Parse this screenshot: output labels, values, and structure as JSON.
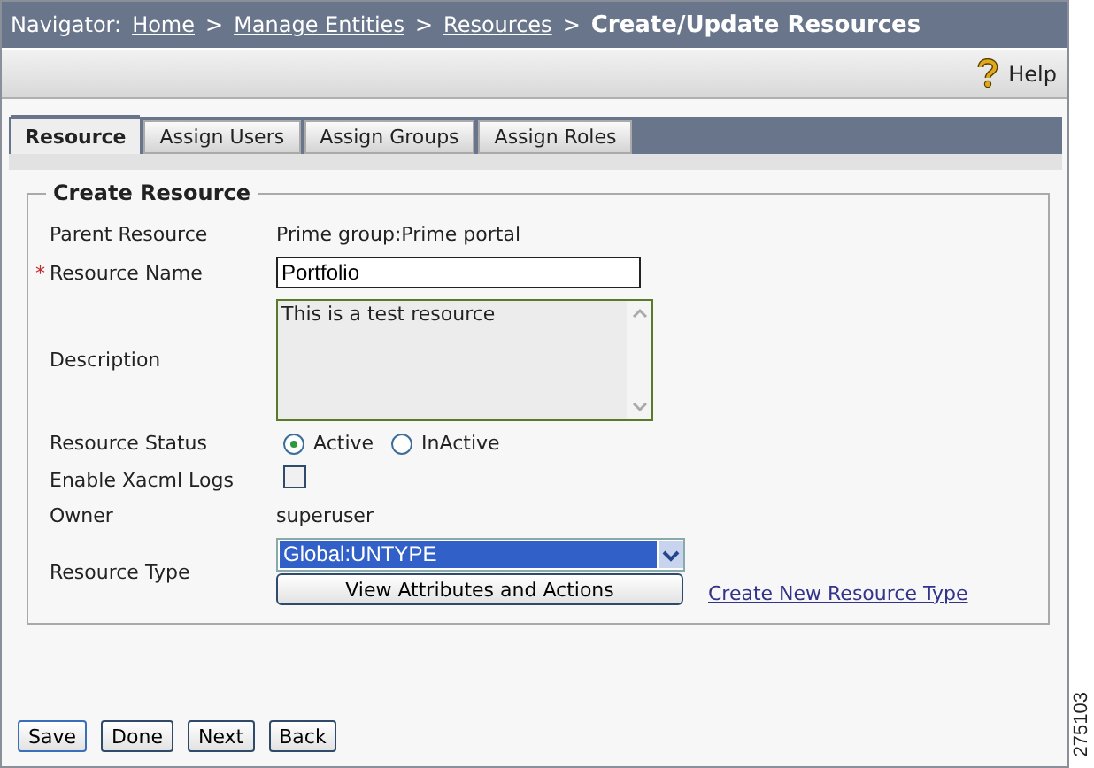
{
  "navigator": {
    "label": "Navigator:",
    "crumbs": [
      {
        "text": "Home",
        "kind": "link"
      },
      {
        "text": "Manage Entities",
        "kind": "link"
      },
      {
        "text": "Resources",
        "kind": "link"
      },
      {
        "text": "Create/Update Resources",
        "kind": "current"
      }
    ],
    "separator": ">"
  },
  "toolbar": {
    "help": "Help"
  },
  "tabs": [
    {
      "label": "Resource",
      "selected": true
    },
    {
      "label": "Assign Users",
      "selected": false
    },
    {
      "label": "Assign Groups",
      "selected": false
    },
    {
      "label": "Assign Roles",
      "selected": false
    }
  ],
  "form": {
    "legend": "Create Resource",
    "required_mark": "*",
    "fields": [
      {
        "kind": "static",
        "label": "Parent Resource",
        "value": "Prime group:Prime portal",
        "required": false
      },
      {
        "kind": "text",
        "label": "Resource Name",
        "value": "Portfolio",
        "required": true
      },
      {
        "kind": "textarea",
        "label": "Description",
        "value": "This is a test resource",
        "required": false
      },
      {
        "kind": "radio",
        "label": "Resource Status",
        "required": false,
        "options": [
          {
            "label": "Active",
            "selected": true
          },
          {
            "label": "InActive",
            "selected": false
          }
        ]
      },
      {
        "kind": "checkbox",
        "label": "Enable Xacml Logs",
        "checked": false,
        "required": false
      },
      {
        "kind": "static",
        "label": "Owner",
        "value": "superuser",
        "required": false
      },
      {
        "kind": "select",
        "label": "Resource Type",
        "value": "Global:UNTYPE",
        "required": false,
        "button": "View Attributes and Actions",
        "link": "Create New Resource Type"
      }
    ]
  },
  "buttons": [
    "Save",
    "Done",
    "Next",
    "Back"
  ],
  "figure_number": "275103"
}
